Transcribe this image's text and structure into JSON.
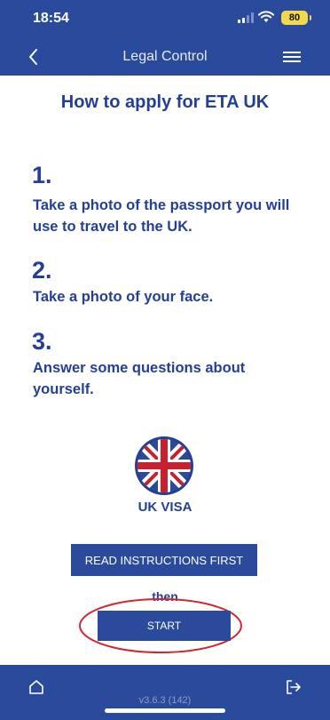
{
  "status_bar": {
    "time": "18:54",
    "battery": "80"
  },
  "header": {
    "title": "Legal Control"
  },
  "main": {
    "title": "How to apply for ETA UK",
    "steps": [
      {
        "number": "1.",
        "text": "Take a photo of the passport you will use to travel to the UK."
      },
      {
        "number": "2.",
        "text": "Take a photo of your face."
      },
      {
        "number": "3.",
        "text": "Answer some questions about yourself."
      }
    ],
    "logo_label": "UK VISA",
    "read_button": "READ INSTRUCTIONS FIRST",
    "then": "then",
    "start_button": "START"
  },
  "footer": {
    "version": "v3.6.3 (142)"
  },
  "colors": {
    "primary": "#2a4a9c",
    "text_blue": "#243f94",
    "highlight": "#d2262f",
    "battery": "#f2d84a"
  },
  "icons": [
    "back-chevron-icon",
    "hamburger-menu-icon",
    "home-icon",
    "logout-icon",
    "signal-icon",
    "wifi-icon",
    "battery-icon"
  ]
}
